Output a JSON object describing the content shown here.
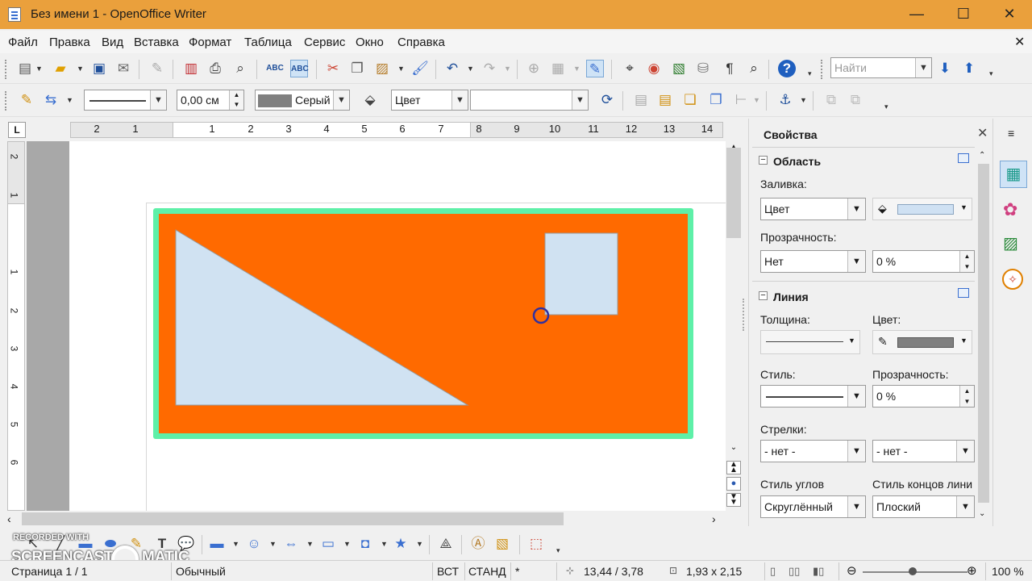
{
  "window": {
    "title": "Без имени 1 - OpenOffice Writer",
    "min": "—",
    "max": "☐",
    "close": "✕"
  },
  "menu": [
    "Файл",
    "Правка",
    "Вид",
    "Вставка",
    "Формат",
    "Таблица",
    "Сервис",
    "Окно",
    "Справка"
  ],
  "menu_close": "✕",
  "toolbar_std": {
    "find_placeholder": "Найти"
  },
  "toolbar_draw": {
    "line_width": "0,00 см",
    "line_color": "Серый",
    "area_style": "Цвет"
  },
  "ruler": {
    "corner": "L",
    "h_labels": [
      "2",
      "1",
      "1",
      "2",
      "3",
      "4",
      "5",
      "6",
      "7",
      "8",
      "9",
      "10",
      "11",
      "12",
      "13",
      "14"
    ],
    "v_labels": [
      "2",
      "1",
      "1",
      "2",
      "3",
      "4",
      "5",
      "6"
    ]
  },
  "sidebar": {
    "title": "Свойства",
    "close": "✕",
    "area": {
      "header": "Область",
      "fill_label": "Заливка:",
      "fill_value": "Цвет",
      "fill_color": "#cfe1f3",
      "transparency_label": "Прозрачность:",
      "transparency_value": "Нет",
      "transparency_pct": "0 %"
    },
    "line": {
      "header": "Линия",
      "width_label": "Толщина:",
      "color_label": "Цвет:",
      "color_value": "#808080",
      "style_label": "Стиль:",
      "transparency_label": "Прозрачность:",
      "transparency_pct": "0 %",
      "arrows_label": "Стрелки:",
      "arrow_start": "- нет -",
      "arrow_end": "- нет -",
      "corner_label": "Стиль углов",
      "corner_value": "Скруглённый",
      "cap_label": "Стиль концов лини",
      "cap_value": "Плоский"
    }
  },
  "drawing": {
    "frame_border": "#5ef0a8",
    "frame_fill": "#ff6a00",
    "shape_fill": "#d0e2f2"
  },
  "watermark": {
    "line1": "RECORDED WITH",
    "line2": "SCREENCAST",
    "line3": "MATIC"
  },
  "status": {
    "page": "Страница  1 / 1",
    "style": "Обычный",
    "mode1": "ВСТ",
    "mode2": "СТАНД",
    "modified": "*",
    "position": "13,44 / 3,78",
    "size": "1,93 x 2,15",
    "zoom": "100 %"
  }
}
